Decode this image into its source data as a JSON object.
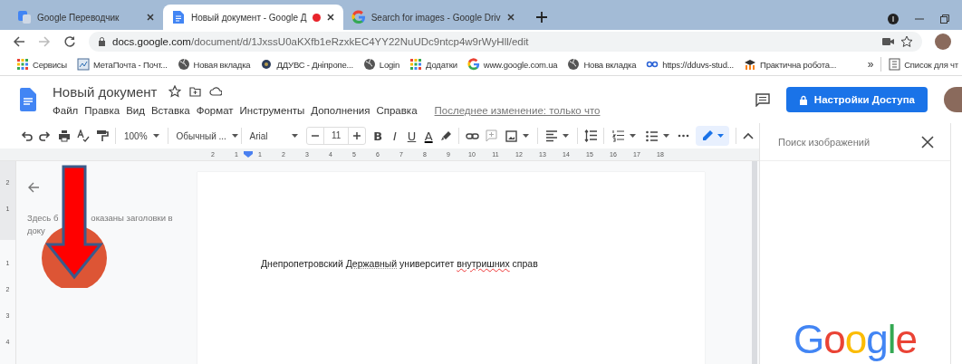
{
  "tabs": [
    {
      "title": "Google Переводчик",
      "kind": "translate",
      "selected": false,
      "recording": false
    },
    {
      "title": "Новый документ - Google Д",
      "kind": "docs",
      "selected": true,
      "recording": true
    },
    {
      "title": "Search for images - Google Driv",
      "kind": "google",
      "selected": false,
      "recording": false
    }
  ],
  "address": {
    "host": "docs.google.com",
    "path": "/document/d/1JxssU0aKXfb1eRzxkEC4YY22NuUDc9ntcp4w9rWyHll/edit"
  },
  "bookmarks": [
    {
      "label": "Сервисы",
      "kind": "apps"
    },
    {
      "label": "МетаПочта - Почт...",
      "kind": "mail"
    },
    {
      "label": "Новая вкладка",
      "kind": "globe"
    },
    {
      "label": "ДДУВС - Дніпропе...",
      "kind": "emblem"
    },
    {
      "label": "Login",
      "kind": "globe"
    },
    {
      "label": "Додатки",
      "kind": "apps"
    },
    {
      "label": "www.google.com.ua",
      "kind": "google"
    },
    {
      "label": "Нова вкладка",
      "kind": "globe"
    },
    {
      "label": "https://dduvs-stud...",
      "kind": "dd"
    },
    {
      "label": "Практична робота...",
      "kind": "moodle"
    }
  ],
  "bookmarks_overflow": "»",
  "reading_list": "Список для чт",
  "document": {
    "title": "Новый документ",
    "menu": [
      "Файл",
      "Правка",
      "Вид",
      "Вставка",
      "Формат",
      "Инструменты",
      "Дополнения",
      "Справка"
    ],
    "last_edit": "Последнее изменение: только что",
    "share_button": "Настройки Доступа"
  },
  "toolbar": {
    "zoom": "100%",
    "style": "Обычный ...",
    "font": "Arial",
    "font_size": "11",
    "format_buttons": [
      "B",
      "I",
      "U",
      "A"
    ]
  },
  "ruler": {
    "horizontal": [
      "2",
      "1",
      "1",
      "2",
      "3",
      "4",
      "5",
      "6",
      "7",
      "8",
      "9",
      "10",
      "11",
      "12",
      "13",
      "14",
      "15",
      "16",
      "17",
      "18"
    ],
    "vertical": [
      "2",
      "1",
      "1",
      "2",
      "3",
      "4"
    ]
  },
  "outline": {
    "texts": [
      "Здесь б",
      "оказаны заголовки в",
      "доку"
    ]
  },
  "body": {
    "segments": [
      {
        "text": "Днепропетровский ",
        "kind": "plain"
      },
      {
        "text": "Державный",
        "kind": "grammar"
      },
      {
        "text": " университет ",
        "kind": "plain"
      },
      {
        "text": "внутришних",
        "kind": "spelling"
      },
      {
        "text": " справ",
        "kind": "plain"
      }
    ]
  },
  "image_search": {
    "placeholder": "Поиск изображений",
    "logo": "Google"
  }
}
